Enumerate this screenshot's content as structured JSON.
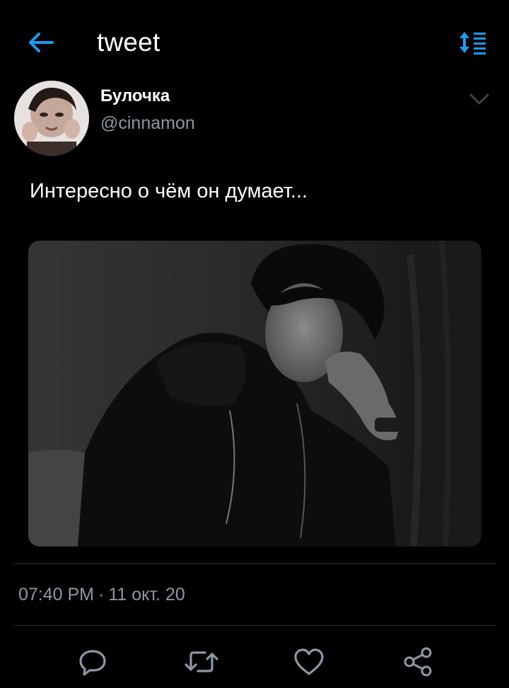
{
  "header": {
    "title": "tweet",
    "back_icon": "arrow-left-icon",
    "sort_icon": "sort-list-icon",
    "accent_color": "#1d9bf0"
  },
  "tweet": {
    "author": {
      "name": "Булочка",
      "handle": "@cinnamon",
      "menu_icon": "chevron-down-icon"
    },
    "text": "Интересно о чём он думает...",
    "media": {
      "kind": "photo",
      "colors": "grayscale"
    },
    "timestamp": {
      "time": "07:40 PM",
      "separator": "·",
      "date": "11 окт. 20"
    }
  },
  "actions": [
    {
      "icon": "reply-icon"
    },
    {
      "icon": "retweet-icon"
    },
    {
      "icon": "like-icon"
    },
    {
      "icon": "share-icon"
    }
  ],
  "colors": {
    "background": "#000000",
    "secondary_text": "#8b98a5",
    "divider": "#26292c"
  }
}
